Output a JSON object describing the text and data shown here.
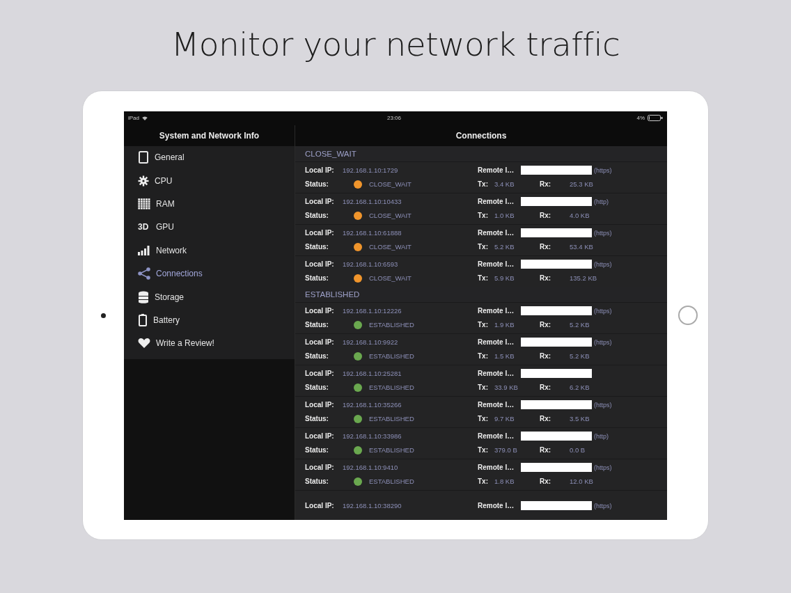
{
  "headline": "Monitor your network traffic",
  "status_bar": {
    "device": "iPad",
    "time": "23:06",
    "battery": "4%"
  },
  "sidebar": {
    "title": "System and Network Info",
    "items": [
      {
        "label": "General",
        "selected": false
      },
      {
        "label": "CPU",
        "selected": false
      },
      {
        "label": "RAM",
        "selected": false
      },
      {
        "label": "GPU",
        "selected": false,
        "icon_text": "3D"
      },
      {
        "label": "Network",
        "selected": false
      },
      {
        "label": "Connections",
        "selected": true
      },
      {
        "label": "Storage",
        "selected": false
      },
      {
        "label": "Battery",
        "selected": false
      },
      {
        "label": "Write a Review!",
        "selected": false
      }
    ]
  },
  "detail": {
    "title": "Connections",
    "sections": [
      {
        "header": "CLOSE_WAIT",
        "rows": [
          {
            "local_label": "Local IP:",
            "local_ip": "192.168.1.10:1729",
            "remote_label": "Remote I…",
            "remote_suffix": "(https)",
            "status_label": "Status:",
            "status": "CLOSE_WAIT",
            "color": "#f0952c",
            "tx_label": "Tx:",
            "tx": "3.4 KB",
            "rx_label": "Rx:",
            "rx": "25.3 KB"
          },
          {
            "local_label": "Local IP:",
            "local_ip": "192.168.1.10:10433",
            "remote_label": "Remote I…",
            "remote_suffix": "(http)",
            "status_label": "Status:",
            "status": "CLOSE_WAIT",
            "color": "#f0952c",
            "tx_label": "Tx:",
            "tx": "1.0 KB",
            "rx_label": "Rx:",
            "rx": "4.0 KB"
          },
          {
            "local_label": "Local IP:",
            "local_ip": "192.168.1.10:61888",
            "remote_label": "Remote I…",
            "remote_suffix": "(https)",
            "status_label": "Status:",
            "status": "CLOSE_WAIT",
            "color": "#f0952c",
            "tx_label": "Tx:",
            "tx": "5.2 KB",
            "rx_label": "Rx:",
            "rx": "53.4 KB"
          },
          {
            "local_label": "Local IP:",
            "local_ip": "192.168.1.10:6593",
            "remote_label": "Remote I…",
            "remote_suffix": "(https)",
            "status_label": "Status:",
            "status": "CLOSE_WAIT",
            "color": "#f0952c",
            "tx_label": "Tx:",
            "tx": "5.9 KB",
            "rx_label": "Rx:",
            "rx": "135.2 KB"
          }
        ]
      },
      {
        "header": "ESTABLISHED",
        "rows": [
          {
            "local_label": "Local IP:",
            "local_ip": "192.168.1.10:12226",
            "remote_label": "Remote I…",
            "remote_suffix": "(https)",
            "status_label": "Status:",
            "status": "ESTABLISHED",
            "color": "#6aa84f",
            "tx_label": "Tx:",
            "tx": "1.9 KB",
            "rx_label": "Rx:",
            "rx": "5.2 KB"
          },
          {
            "local_label": "Local IP:",
            "local_ip": "192.168.1.10:9922",
            "remote_label": "Remote I…",
            "remote_suffix": "(https)",
            "status_label": "Status:",
            "status": "ESTABLISHED",
            "color": "#6aa84f",
            "tx_label": "Tx:",
            "tx": "1.5 KB",
            "rx_label": "Rx:",
            "rx": "5.2 KB"
          },
          {
            "local_label": "Local IP:",
            "local_ip": "192.168.1.10:25281",
            "remote_label": "Remote I…",
            "status_label": "Status:",
            "status": "ESTABLISHED",
            "color": "#6aa84f",
            "tx_label": "Tx:",
            "tx": "33.9 KB",
            "rx_label": "Rx:",
            "rx": "6.2 KB"
          },
          {
            "local_label": "Local IP:",
            "local_ip": "192.168.1.10:35266",
            "remote_label": "Remote I…",
            "remote_suffix": "(https)",
            "status_label": "Status:",
            "status": "ESTABLISHED",
            "color": "#6aa84f",
            "tx_label": "Tx:",
            "tx": "9.7 KB",
            "rx_label": "Rx:",
            "rx": "3.5 KB"
          },
          {
            "local_label": "Local IP:",
            "local_ip": "192.168.1.10:33986",
            "remote_label": "Remote I…",
            "remote_suffix": "(http)",
            "status_label": "Status:",
            "status": "ESTABLISHED",
            "color": "#6aa84f",
            "tx_label": "Tx:",
            "tx": "379.0 B",
            "rx_label": "Rx:",
            "rx": "0.0 B"
          },
          {
            "local_label": "Local IP:",
            "local_ip": "192.168.1.10:9410",
            "remote_label": "Remote I…",
            "remote_suffix": "(https)",
            "status_label": "Status:",
            "status": "ESTABLISHED",
            "color": "#6aa84f",
            "tx_label": "Tx:",
            "tx": "1.8 KB",
            "rx_label": "Rx:",
            "rx": "12.0 KB"
          },
          {
            "local_label": "Local IP:",
            "local_ip": "192.168.1.10:38290",
            "remote_label": "Remote I…",
            "remote_suffix": "(https)"
          }
        ]
      }
    ]
  }
}
